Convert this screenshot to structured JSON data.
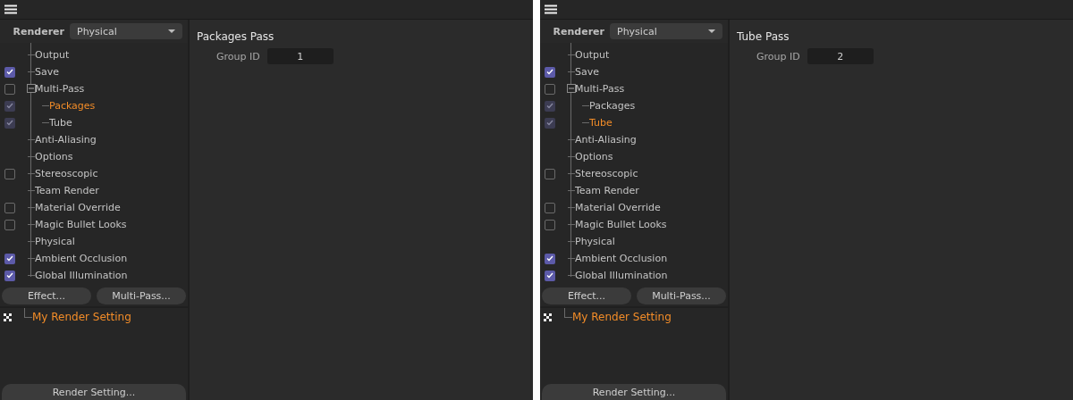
{
  "panels": [
    {
      "renderer": {
        "label": "Renderer",
        "value": "Physical"
      },
      "tree": [
        {
          "label": "Output",
          "kind": "plain",
          "selected": false
        },
        {
          "label": "Save",
          "kind": "toggle",
          "checked": true,
          "disabled": false,
          "selected": false
        },
        {
          "label": "Multi-Pass",
          "kind": "toggle",
          "checked": false,
          "disabled": false,
          "selected": false,
          "expanded": true,
          "children": [
            {
              "label": "Packages",
              "kind": "toggle",
              "checked": true,
              "disabled": true,
              "selected": true
            },
            {
              "label": "Tube",
              "kind": "toggle",
              "checked": true,
              "disabled": true,
              "selected": false
            }
          ]
        },
        {
          "label": "Anti-Aliasing",
          "kind": "plain",
          "selected": false
        },
        {
          "label": "Options",
          "kind": "plain",
          "selected": false
        },
        {
          "label": "Stereoscopic",
          "kind": "toggle",
          "checked": false,
          "disabled": false,
          "selected": false
        },
        {
          "label": "Team Render",
          "kind": "plain",
          "selected": false
        },
        {
          "label": "Material Override",
          "kind": "toggle",
          "checked": false,
          "disabled": false,
          "selected": false
        },
        {
          "label": "Magic Bullet Looks",
          "kind": "toggle",
          "checked": false,
          "disabled": false,
          "selected": false
        },
        {
          "label": "Physical",
          "kind": "plain",
          "selected": false
        },
        {
          "label": "Ambient Occlusion",
          "kind": "toggle",
          "checked": true,
          "disabled": false,
          "selected": false
        },
        {
          "label": "Global Illumination",
          "kind": "toggle",
          "checked": true,
          "disabled": false,
          "selected": false
        }
      ],
      "buttons": [
        "Effect...",
        "Multi-Pass..."
      ],
      "settings": [
        {
          "label": "My Render Setting",
          "selected": true
        }
      ],
      "footer_button": "Render Setting...",
      "pass": {
        "title": "Packages Pass",
        "field_label": "Group ID",
        "field_value": "1"
      }
    },
    {
      "renderer": {
        "label": "Renderer",
        "value": "Physical"
      },
      "tree": [
        {
          "label": "Output",
          "kind": "plain",
          "selected": false
        },
        {
          "label": "Save",
          "kind": "toggle",
          "checked": true,
          "disabled": false,
          "selected": false
        },
        {
          "label": "Multi-Pass",
          "kind": "toggle",
          "checked": false,
          "disabled": false,
          "selected": false,
          "expanded": true,
          "children": [
            {
              "label": "Packages",
              "kind": "toggle",
              "checked": true,
              "disabled": true,
              "selected": false
            },
            {
              "label": "Tube",
              "kind": "toggle",
              "checked": true,
              "disabled": true,
              "selected": true
            }
          ]
        },
        {
          "label": "Anti-Aliasing",
          "kind": "plain",
          "selected": false
        },
        {
          "label": "Options",
          "kind": "plain",
          "selected": false
        },
        {
          "label": "Stereoscopic",
          "kind": "toggle",
          "checked": false,
          "disabled": false,
          "selected": false
        },
        {
          "label": "Team Render",
          "kind": "plain",
          "selected": false
        },
        {
          "label": "Material Override",
          "kind": "toggle",
          "checked": false,
          "disabled": false,
          "selected": false
        },
        {
          "label": "Magic Bullet Looks",
          "kind": "toggle",
          "checked": false,
          "disabled": false,
          "selected": false
        },
        {
          "label": "Physical",
          "kind": "plain",
          "selected": false
        },
        {
          "label": "Ambient Occlusion",
          "kind": "toggle",
          "checked": true,
          "disabled": false,
          "selected": false
        },
        {
          "label": "Global Illumination",
          "kind": "toggle",
          "checked": true,
          "disabled": false,
          "selected": false
        }
      ],
      "buttons": [
        "Effect...",
        "Multi-Pass..."
      ],
      "settings": [
        {
          "label": "My Render Setting",
          "selected": true
        }
      ],
      "footer_button": "Render Setting...",
      "pass": {
        "title": "Tube Pass",
        "field_label": "Group ID",
        "field_value": "2"
      }
    }
  ]
}
